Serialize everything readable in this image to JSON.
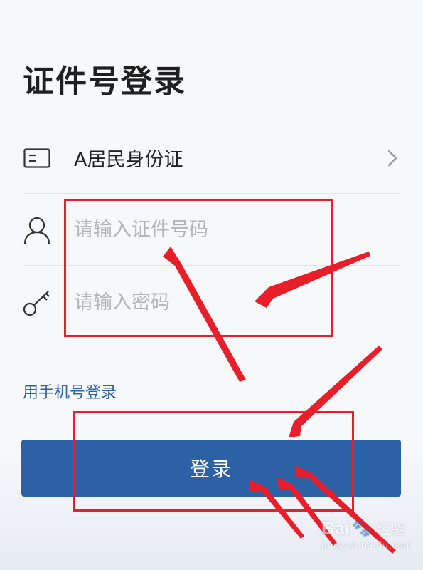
{
  "page": {
    "title": "证件号登录"
  },
  "id_type": {
    "icon": "id-card-icon",
    "value": "A居民身份证",
    "chevron": "chevron-right-icon"
  },
  "id_number": {
    "icon": "user-icon",
    "placeholder": "请输入证件号码"
  },
  "password": {
    "icon": "key-icon",
    "placeholder": "请输入密码"
  },
  "switch_link": {
    "label": "用手机号登录"
  },
  "login_button": {
    "label": "登录"
  },
  "colors": {
    "accent": "#2c61a6",
    "link": "#2b62a6",
    "annotation_red": "#e81f2a",
    "placeholder": "#b3b5b9"
  },
  "watermark": {
    "brand_left": "Bai",
    "brand_right": "经验",
    "url": "jingyan.baidu.com"
  }
}
